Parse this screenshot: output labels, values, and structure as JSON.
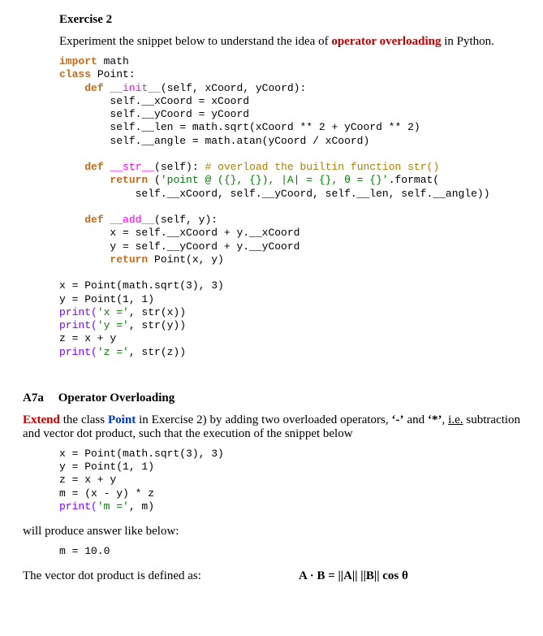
{
  "ex2": {
    "title": "Exercise 2",
    "intro_pre": "Experiment the snippet below to understand the idea of ",
    "intro_em": "operator overloading",
    "intro_post": " in Python.",
    "code": {
      "l1_kw": "import",
      "l1_mod": " math",
      "l2_kw": "class",
      "l2_rest": " Point:",
      "l3_kw": "def",
      "l3_dun": "__init__",
      "l3_sig": "(self, xCoord, yCoord):",
      "l4": "self.__xCoord = xCoord",
      "l5": "self.__yCoord = yCoord",
      "l6": "self.__len = math.sqrt(xCoord ** 2 + yCoord ** 2)",
      "l7": "self.__angle = math.atan(yCoord / xCoord)",
      "l8_kw": "def",
      "l8_dun": "__str__",
      "l8_sig": "(self): ",
      "l8_cmt": "# overload the builtin function str()",
      "l9_kw": "return",
      "l9_rest": " (",
      "l9_str": "'point @ ({}, {}), |A| = {}, θ = {}'",
      "l9_post": ".format(",
      "l10": "self.__xCoord, self.__yCoord, self.__len, self.__angle))",
      "l11_kw": "def",
      "l11_dun": "__add__",
      "l11_sig": "(self, y):",
      "l12": "x = self.__xCoord + y.__xCoord",
      "l13": "y = self.__yCoord + y.__yCoord",
      "l14_kw": "return",
      "l14_rest": " Point(x, y)",
      "m1": "x = Point(math.sqrt(3), 3)",
      "m2": "y = Point(1, 1)",
      "m3a": "print(",
      "m3s": "'x ='",
      "m3b": ", str(x))",
      "m4a": "print(",
      "m4s": "'y ='",
      "m4b": ", str(y))",
      "m5": "z = x + y",
      "m6a": "print(",
      "m6s": "'z ='",
      "m6b": ", str(z))"
    }
  },
  "a7a": {
    "label": "A7a",
    "title": "Operator Overloading",
    "para_extend": "Extend",
    "para_1": " the class ",
    "para_point": "Point",
    "para_2": " in Exercise 2) by adding two overloaded operators, ",
    "op_minus": "‘-’",
    "para_and": " and ",
    "op_star": "‘*’",
    "para_comma": ", ",
    "para_ie": "i.e.",
    "para_3": " subtraction and vector dot product, such that the execution of the snippet below",
    "code": {
      "c1": "x = Point(math.sqrt(3), 3)",
      "c2": "y = Point(1, 1)",
      "c3": "z = x + y",
      "c4": "m = (x - y) * z",
      "c5a": "print(",
      "c5s": "'m ='",
      "c5b": ", m)"
    },
    "will_produce": "will produce answer like below:",
    "output": "m = 10.0",
    "dot_text": "The vector dot product is defined as:",
    "formula": "A · B = ||A|| ||B|| cos θ"
  }
}
